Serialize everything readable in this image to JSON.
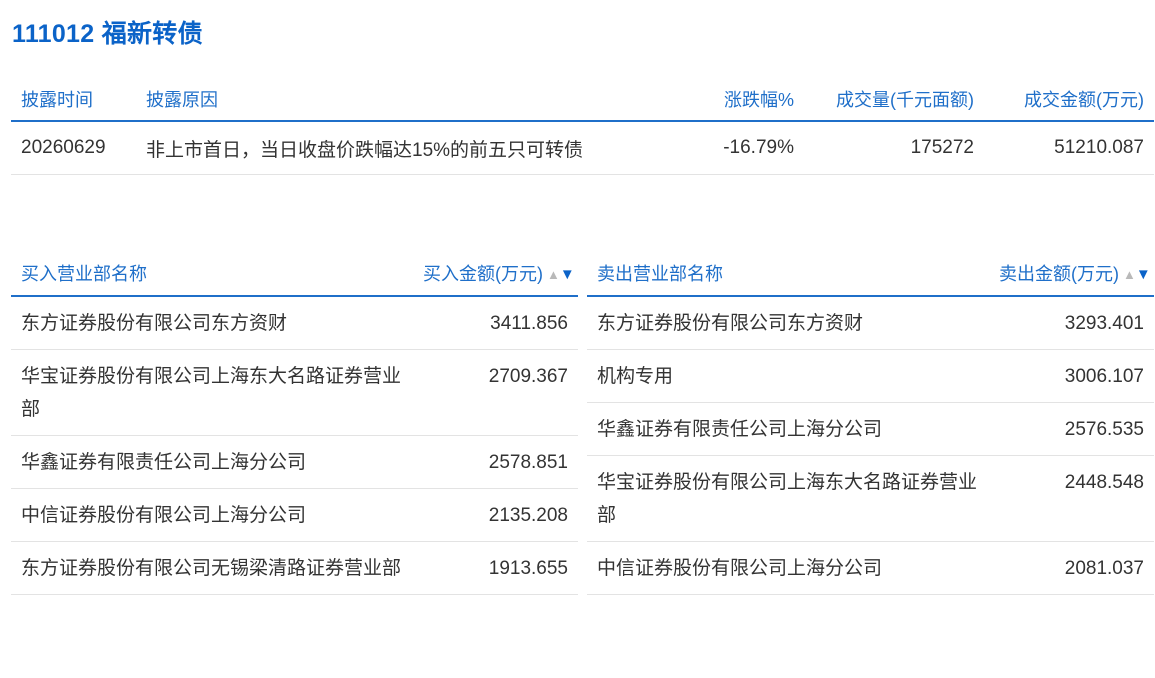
{
  "title": "111012 福新转债",
  "disclosure": {
    "headers": {
      "date": "披露时间",
      "reason": "披露原因",
      "change": "涨跌幅%",
      "volume": "成交量(千元面额)",
      "amount": "成交金额(万元)"
    },
    "row": {
      "date": "20260629",
      "reason": "非上市首日，当日收盘价跌幅达15%的前五只可转债",
      "change": "-16.79%",
      "volume": "175272",
      "amount": "51210.087"
    }
  },
  "buy": {
    "headers": {
      "name": "买入营业部名称",
      "amount": "买入金额(万元)"
    },
    "rows": [
      {
        "name": "东方证券股份有限公司东方资财",
        "amount": "3411.856"
      },
      {
        "name": "华宝证券股份有限公司上海东大名路证券营业部",
        "amount": "2709.367"
      },
      {
        "name": "华鑫证券有限责任公司上海分公司",
        "amount": "2578.851"
      },
      {
        "name": "中信证券股份有限公司上海分公司",
        "amount": "2135.208"
      },
      {
        "name": "东方证券股份有限公司无锡梁清路证券营业部",
        "amount": "1913.655"
      }
    ]
  },
  "sell": {
    "headers": {
      "name": "卖出营业部名称",
      "amount": "卖出金额(万元)"
    },
    "rows": [
      {
        "name": "东方证券股份有限公司东方资财",
        "amount": "3293.401"
      },
      {
        "name": "机构专用",
        "amount": "3006.107"
      },
      {
        "name": "华鑫证券有限责任公司上海分公司",
        "amount": "2576.535"
      },
      {
        "name": "华宝证券股份有限公司上海东大名路证券营业部",
        "amount": "2448.548"
      },
      {
        "name": "中信证券股份有限公司上海分公司",
        "amount": "2081.037"
      }
    ]
  },
  "icons": {
    "sort_up": "▲",
    "sort_down": "▼"
  },
  "colors": {
    "accent": "#1f6fc9",
    "title": "#0b63c8",
    "text": "#333333",
    "divider": "#e3e3e3"
  }
}
